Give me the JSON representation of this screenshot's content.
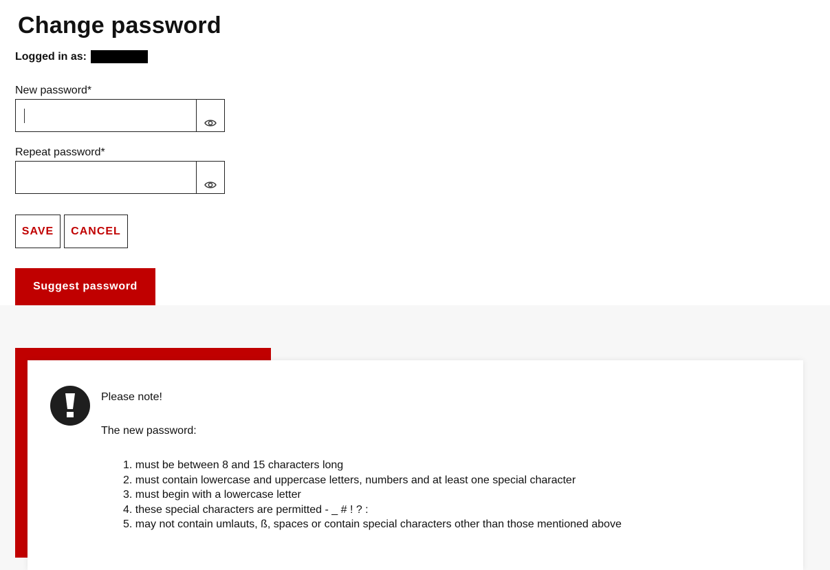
{
  "page": {
    "title": "Change password",
    "logged_in_label": "Logged in as:"
  },
  "form": {
    "new_password": {
      "label": "New password*",
      "value": "",
      "placeholder": ""
    },
    "repeat_password": {
      "label": "Repeat password*",
      "value": "",
      "placeholder": ""
    },
    "icons": {
      "toggle_visibility": "eye-icon"
    }
  },
  "actions": {
    "save_label": "SAVE",
    "cancel_label": "CANCEL",
    "suggest_label": "Suggest password"
  },
  "note": {
    "icon": "exclamation-icon",
    "heading": "Please note!",
    "intro": "The new password:",
    "rules": [
      "1. must be between 8 and 15 characters long",
      "2. must contain lowercase and uppercase letters, numbers and at least one special character",
      "3. must begin with a lowercase letter",
      "4. these special characters are permitted - _ # ! ? :",
      "5. may not contain umlauts, ß, spaces or contain special characters other than those mentioned above"
    ]
  },
  "colors": {
    "accent": "#c00000",
    "text": "#111111",
    "panel_background": "#f7f7f7",
    "icon_circle": "#1e1e1e"
  }
}
